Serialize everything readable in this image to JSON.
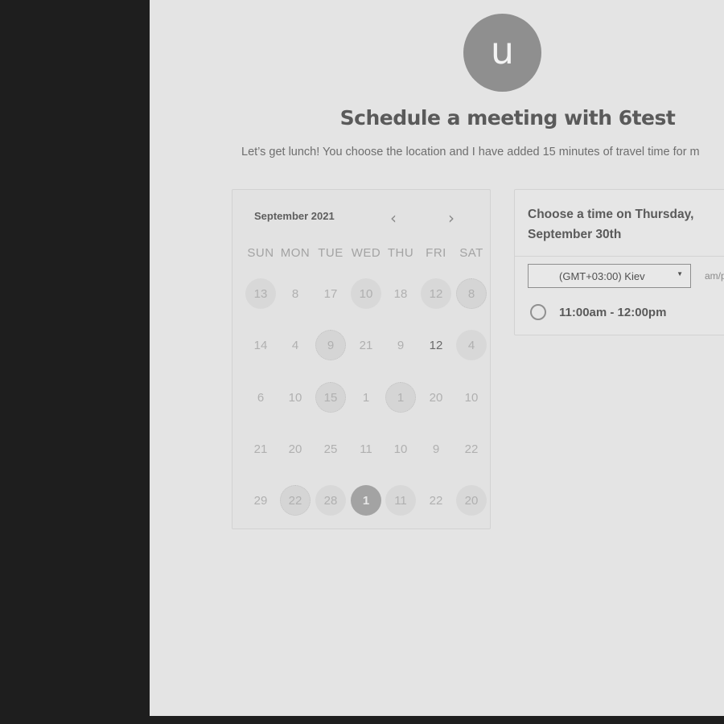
{
  "avatar": {
    "letter": "u"
  },
  "page": {
    "title": "Schedule a meeting with 6test",
    "subtitle": "Let’s get lunch! You choose the location and I have added 15 minutes of travel time for m"
  },
  "calendar": {
    "month_label": "September 2021",
    "prev_icon": "chevron-left-icon",
    "next_icon": "chevron-right-icon",
    "prev_glyph": "‹",
    "next_glyph": "›",
    "weekdays": [
      "SUN",
      "MON",
      "TUE",
      "WED",
      "THU",
      "FRI",
      "SAT"
    ],
    "weeks": [
      [
        {
          "d": "13",
          "s": "shade"
        },
        {
          "d": "8",
          "s": ""
        },
        {
          "d": "17",
          "s": ""
        },
        {
          "d": "10",
          "s": "shade"
        },
        {
          "d": "18",
          "s": ""
        },
        {
          "d": "12",
          "s": "shade"
        },
        {
          "d": "8",
          "s": "dot"
        }
      ],
      [
        {
          "d": "14",
          "s": ""
        },
        {
          "d": "4",
          "s": ""
        },
        {
          "d": "9",
          "s": "dot"
        },
        {
          "d": "21",
          "s": ""
        },
        {
          "d": "9",
          "s": ""
        },
        {
          "d": "12",
          "s": "avail"
        },
        {
          "d": "4",
          "s": "shade"
        }
      ],
      [
        {
          "d": "6",
          "s": ""
        },
        {
          "d": "10",
          "s": ""
        },
        {
          "d": "15",
          "s": "dot"
        },
        {
          "d": "1",
          "s": ""
        },
        {
          "d": "1",
          "s": "dot"
        },
        {
          "d": "20",
          "s": ""
        },
        {
          "d": "10",
          "s": ""
        }
      ],
      [
        {
          "d": "21",
          "s": ""
        },
        {
          "d": "20",
          "s": ""
        },
        {
          "d": "25",
          "s": ""
        },
        {
          "d": "11",
          "s": ""
        },
        {
          "d": "10",
          "s": ""
        },
        {
          "d": "9",
          "s": ""
        },
        {
          "d": "22",
          "s": ""
        }
      ],
      [
        {
          "d": "29",
          "s": ""
        },
        {
          "d": "22",
          "s": "dot"
        },
        {
          "d": "28",
          "s": "shade"
        },
        {
          "d": "1",
          "s": "sel"
        },
        {
          "d": "11",
          "s": "shade"
        },
        {
          "d": "22",
          "s": ""
        },
        {
          "d": "20",
          "s": "shade"
        }
      ]
    ]
  },
  "time_panel": {
    "heading": "Choose a time on Thursday, September 30th",
    "timezone": "(GMT+03:00) Kiev",
    "timezone_caret": "▼",
    "format_label": "am/p",
    "slot": "11:00am - 12:00pm"
  }
}
